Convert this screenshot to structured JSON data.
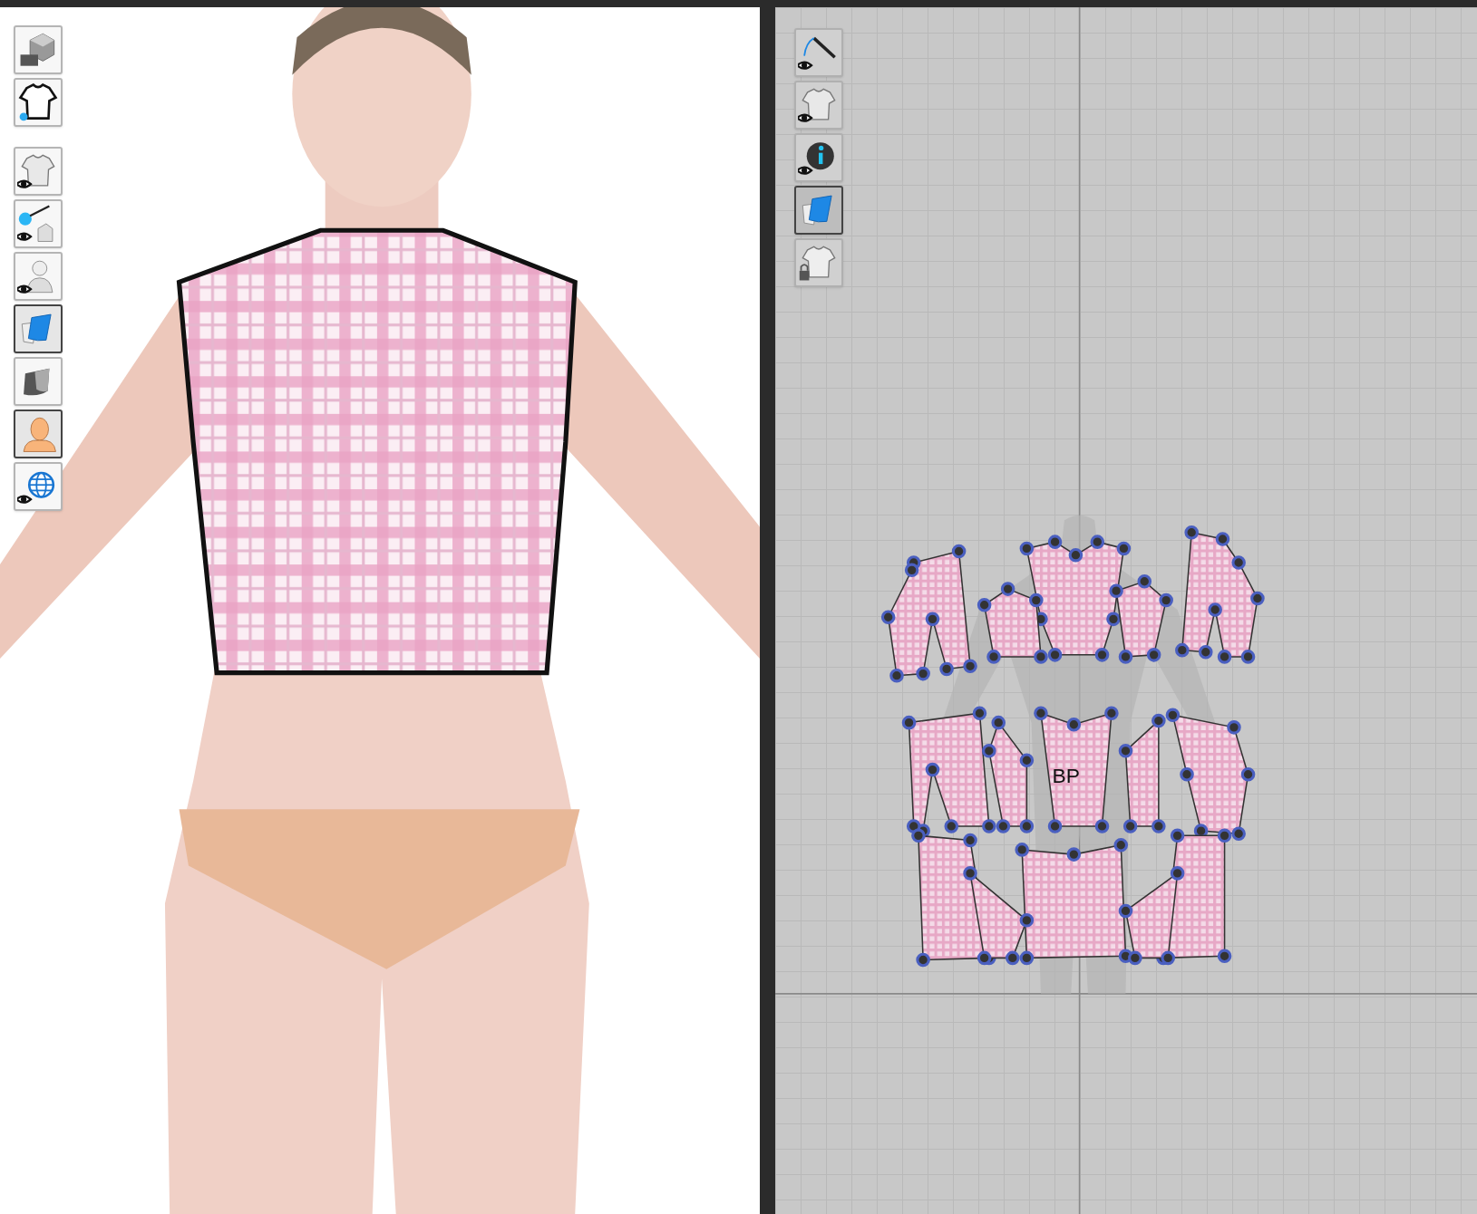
{
  "viewport_3d": {
    "toolbar_groups": [
      {
        "buttons": [
          {
            "kind": "render",
            "active": false
          },
          {
            "kind": "garment",
            "active": false
          }
        ]
      },
      {
        "buttons": [
          {
            "kind": "show-garment",
            "active": false
          },
          {
            "kind": "show-trims",
            "active": false
          },
          {
            "kind": "show-avatar",
            "active": false
          },
          {
            "kind": "texture",
            "active": true
          },
          {
            "kind": "shading",
            "active": false
          },
          {
            "kind": "avatar",
            "active": true
          },
          {
            "kind": "globe",
            "active": false
          }
        ]
      }
    ]
  },
  "viewport_2d": {
    "toolbar": [
      {
        "kind": "show-sewing",
        "active": false
      },
      {
        "kind": "show-garment",
        "active": false
      },
      {
        "kind": "info",
        "active": false
      },
      {
        "kind": "texture",
        "active": true
      },
      {
        "kind": "lock-garment",
        "active": false
      }
    ],
    "labels": [
      "BP"
    ]
  }
}
